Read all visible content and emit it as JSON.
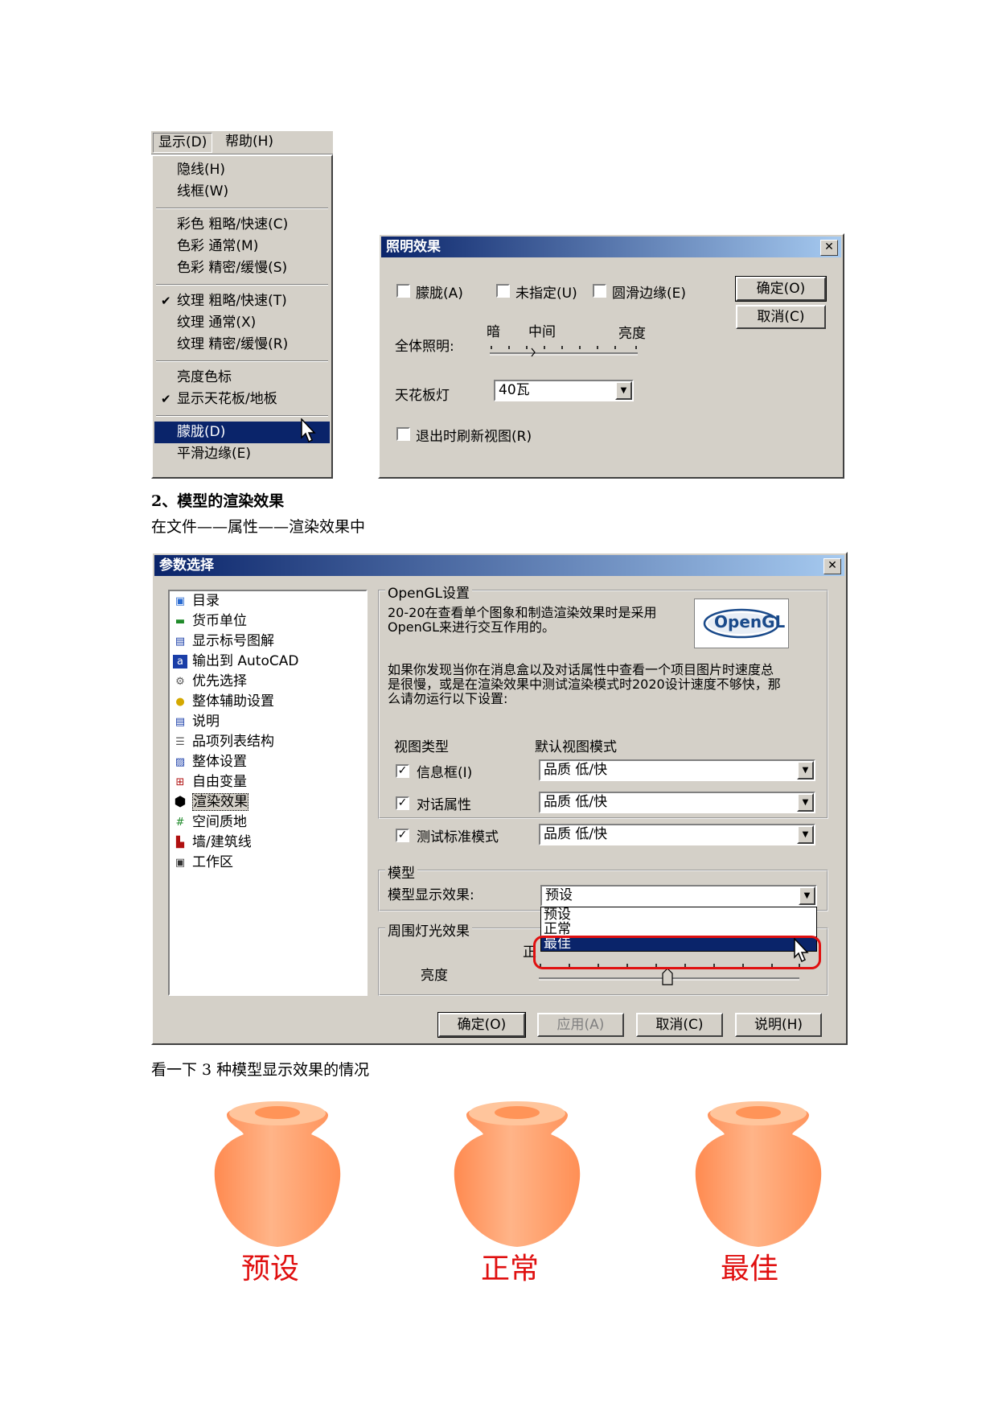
{
  "menu": {
    "bar": {
      "display": "显示(D)",
      "help": "帮助(H)"
    },
    "items": [
      {
        "label": "隐线(H)",
        "checked": false
      },
      {
        "label": "线框(W)",
        "checked": false
      },
      {
        "label": "彩色 粗略/快速(C)",
        "checked": false
      },
      {
        "label": "色彩 通常(M)",
        "checked": false
      },
      {
        "label": "色彩 精密/缓慢(S)",
        "checked": false
      },
      {
        "label": "纹理 粗略/快速(T)",
        "checked": true
      },
      {
        "label": "纹理 通常(X)",
        "checked": false
      },
      {
        "label": "纹理 精密/缓慢(R)",
        "checked": false
      },
      {
        "label": "亮度色标",
        "checked": false
      },
      {
        "label": "显示天花板/地板",
        "checked": true
      },
      {
        "label": "朦胧(D)",
        "checked": false,
        "selected": true
      },
      {
        "label": "平滑边缘(E)",
        "checked": false
      }
    ]
  },
  "lighting_dialog": {
    "title": "照明效果",
    "checkbox_haze": "朦胧(A)",
    "checkbox_unspecified": "未指定(U)",
    "checkbox_smooth": "圆滑边缘(E)",
    "ok": "确定(O)",
    "cancel": "取消(C)",
    "slider_dark": "暗",
    "slider_mid": "中间",
    "slider_bright": "亮度",
    "overall_label": "全体照明:",
    "ceiling_label": "天花板灯",
    "ceiling_value": "40瓦",
    "refresh_label": "退出时刷新视图(R)"
  },
  "doc": {
    "heading": "2、模型的渲染效果",
    "path": "在文件——属性——渲染效果中",
    "caption": "看一下 3 种模型显示效果的情况"
  },
  "pref_dialog": {
    "title": "参数选择",
    "tree": [
      {
        "label": "目录",
        "icon": "folder-icon"
      },
      {
        "label": "货币单位",
        "icon": "money-icon"
      },
      {
        "label": "显示标号图解",
        "icon": "legend-icon"
      },
      {
        "label": "输出到 AutoCAD",
        "icon": "autocad-icon"
      },
      {
        "label": "优先选择",
        "icon": "gear-icon"
      },
      {
        "label": "整体辅助设置",
        "icon": "bulb-icon"
      },
      {
        "label": "说明",
        "icon": "info-icon"
      },
      {
        "label": "品项列表结构",
        "icon": "list-icon"
      },
      {
        "label": "整体设置",
        "icon": "settings-icon"
      },
      {
        "label": "自由变量",
        "icon": "variable-icon"
      },
      {
        "label": "渲染效果",
        "icon": "render-icon",
        "selected": true
      },
      {
        "label": "空间质地",
        "icon": "grid-icon"
      },
      {
        "label": "墙/建筑线",
        "icon": "wall-icon"
      },
      {
        "label": "工作区",
        "icon": "workspace-icon"
      }
    ],
    "opengl_group": "OpenGL设置",
    "opengl_text1a": "20-20在查看单个图象和制造渲染效果时是采用",
    "opengl_text1b": "OpenGL来进行交互作用的。",
    "opengl_text2a": "如果你发现当你在消息盒以及对话属性中查看一个项目图片时速度总",
    "opengl_text2b": "是很慢，或是在渲染效果中测试渲染模式时2020设计速度不够快，那",
    "opengl_text2c": "么请勿运行以下设置:",
    "opengl_logo": "OpenGL",
    "col_view_type": "视图类型",
    "col_default_mode": "默认视图模式",
    "rows": [
      {
        "label": "信息框(I)",
        "value": "品质 低/快",
        "checked": true
      },
      {
        "label": "对话属性",
        "value": "品质 低/快",
        "checked": true
      },
      {
        "label": "测试标准模式",
        "value": "品质 低/快",
        "checked": true
      }
    ],
    "model_group": "模型",
    "model_label": "模型显示效果:",
    "model_value": "预设",
    "model_options": [
      "预设",
      "正常",
      "最佳"
    ],
    "ambient_group": "周围灯光效果",
    "ambient_partial": "正",
    "brightness_label": "亮度",
    "ok": "确定(O)",
    "apply": "应用(A)",
    "cancel": "取消(C)",
    "help": "说明(H)"
  },
  "vases": {
    "captions": [
      "预设",
      "正常",
      "最佳"
    ],
    "color": "#ff9a5c"
  }
}
